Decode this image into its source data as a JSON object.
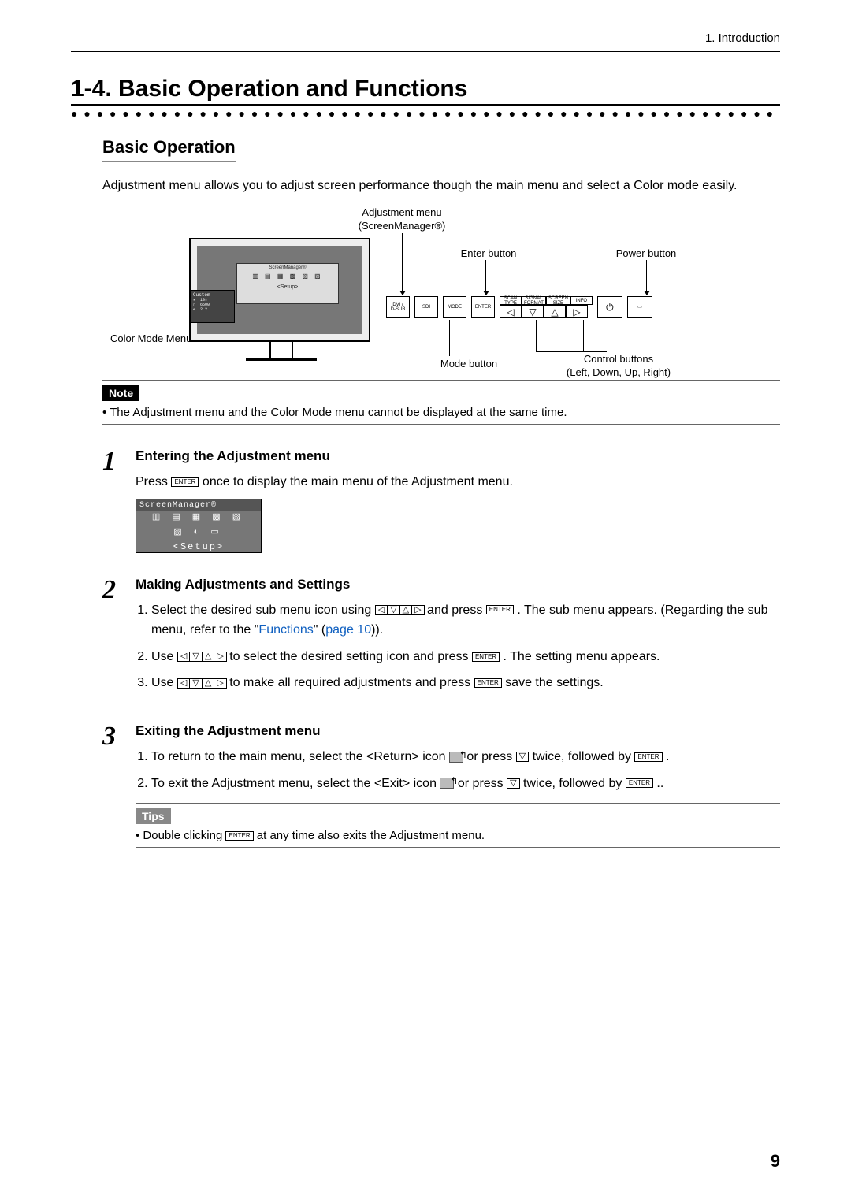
{
  "header": {
    "chapter": "1. Introduction"
  },
  "title": "1-4. Basic Operation and Functions",
  "subtitle": "Basic Operation",
  "intro": "Adjustment menu allows you to adjust screen performance though the main menu and select a Color mode easily.",
  "diagram": {
    "adjustment_menu_label_l1": "Adjustment menu",
    "adjustment_menu_label_l2": "(ScreenManager®)",
    "enter_button": "Enter button",
    "power_button": "Power button",
    "color_mode_menu": "Color Mode Menu",
    "mode_button": "Mode button",
    "control_buttons_l1": "Control buttons",
    "control_buttons_l2": "(Left, Down, Up, Right)",
    "sm_title": "ScreenManager®",
    "sm_setup": "<Setup>",
    "cm_title": "Custom",
    "cm_rows": "✳  10×\n▯  6500\n◐  2.2",
    "buttons": {
      "dvi": "DVI /\nD-SUB",
      "sdi": "SDI",
      "mode": "MODE",
      "enter": "ENTER",
      "scan": "SCAN\nTYPE",
      "signal": "SIGNAL\nFORMAT",
      "screen": "SCREEN\nSIZE",
      "info": "INFO"
    }
  },
  "note": {
    "label": "Note",
    "text": "• The Adjustment menu and the Color Mode menu cannot be displayed at the same time."
  },
  "steps": [
    {
      "num": "1",
      "title": "Entering the Adjustment menu",
      "press_before": "Press ",
      "press_after": " once to display the main menu of the Adjustment menu.",
      "shot_title": "ScreenManager®",
      "shot_setup": "<Setup>"
    },
    {
      "num": "2",
      "title": "Making Adjustments and Settings",
      "li1_a": "Select the desired sub menu icon using ",
      "li1_b": " and press ",
      "li1_c": " . The sub menu appears. (Regarding the sub menu, refer to the \"",
      "li1_link1": "Functions",
      "li1_mid": "\" (",
      "li1_link2": "page 10",
      "li1_end": ")).",
      "li2_a": "Use ",
      "li2_b": " to select the desired setting icon and press ",
      "li2_c": " . The setting menu appears.",
      "li3_a": "Use ",
      "li3_b": " to make all required adjustments and press ",
      "li3_c": "  save the settings."
    },
    {
      "num": "3",
      "title": "Exiting the Adjustment menu",
      "li1_a": "To return to the main menu, select the <Return> icon ",
      "li1_b": " or press ",
      "li1_c": " twice, followed by ",
      "li1_d": " .",
      "li2_a": "To exit the Adjustment menu, select the <Exit> icon  ",
      "li2_b": " or press ",
      "li2_c": " twice, followed by ",
      "li2_d": " .."
    }
  ],
  "tips": {
    "label": "Tips",
    "before": "• Double clicking ",
    "after": " at any time also exits the Adjustment menu."
  },
  "keys": {
    "enter": "ENTER",
    "left": "◁",
    "down": "▽",
    "up": "△",
    "right": "▷"
  },
  "page_number": "9"
}
